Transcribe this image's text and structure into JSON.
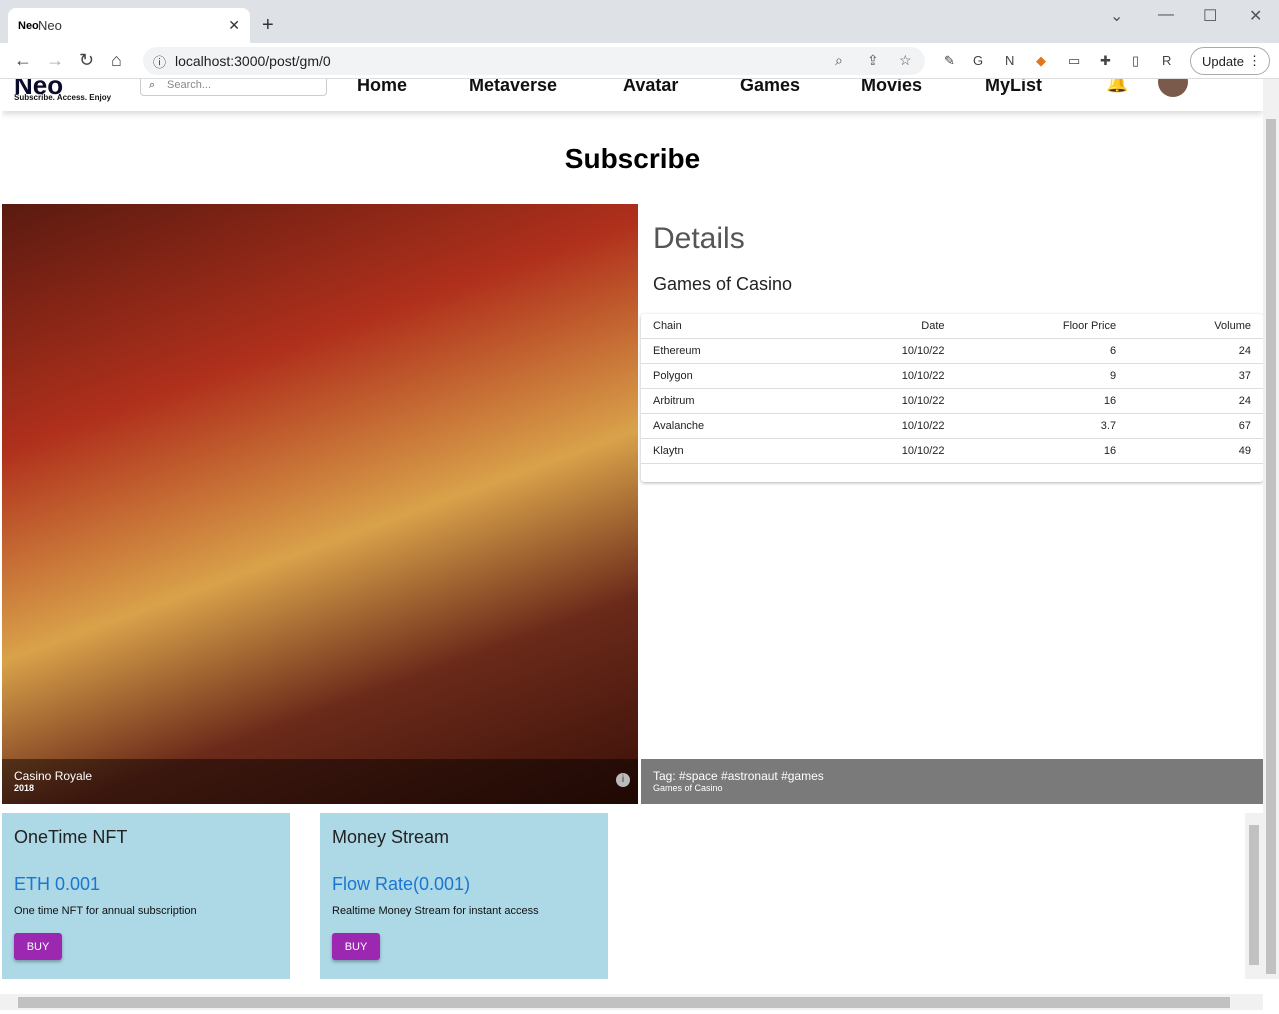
{
  "browser": {
    "tab_title": "Neo",
    "tab_icon": "Neo",
    "url": "localhost:3000/post/gm/0",
    "update_label": "Update"
  },
  "site": {
    "logo": "Neo",
    "tagline": "Subscribe. Access. Enjoy",
    "search_placeholder": "Search...",
    "nav": [
      "Home",
      "Metaverse",
      "Avatar",
      "Games",
      "Movies",
      "MyList"
    ]
  },
  "page": {
    "title": "Subscribe"
  },
  "hero": {
    "title": "Casino Royale",
    "subtitle": "2018"
  },
  "details": {
    "heading": "Details",
    "subheading": "Games of Casino",
    "columns": [
      "Chain",
      "Date",
      "Floor Price",
      "Volume"
    ],
    "rows": [
      [
        "Ethereum",
        "10/10/22",
        "6",
        "24"
      ],
      [
        "Polygon",
        "10/10/22",
        "9",
        "37"
      ],
      [
        "Arbitrum",
        "10/10/22",
        "16",
        "24"
      ],
      [
        "Avalanche",
        "10/10/22",
        "3.7",
        "67"
      ],
      [
        "Klaytn",
        "10/10/22",
        "16",
        "49"
      ]
    ],
    "tag_title": "Tag: #space #astronaut #games",
    "tag_subtitle": "Games of Casino"
  },
  "cards": [
    {
      "title": "OneTime NFT",
      "price": "ETH 0.001",
      "desc": "One time NFT for annual subscription",
      "button": "BUY"
    },
    {
      "title": "Money Stream",
      "price": "Flow Rate(0.001)",
      "desc": "Realtime Money Stream for instant access",
      "button": "BUY"
    }
  ],
  "colors": {
    "card_bg": "#add8e6",
    "buy_button": "#9c27b0",
    "price_text": "#1976d2"
  }
}
